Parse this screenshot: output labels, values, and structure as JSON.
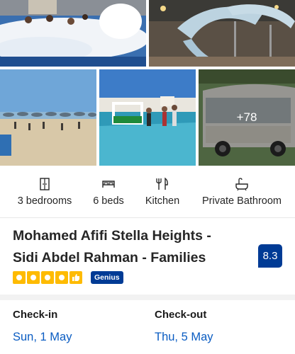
{
  "gallery": {
    "more_photos_label": "+78"
  },
  "amenities": [
    {
      "icon": "door-icon",
      "label": "3 bedrooms"
    },
    {
      "icon": "bed-icon",
      "label": "6 beds"
    },
    {
      "icon": "fork-knife-icon",
      "label": "Kitchen"
    },
    {
      "icon": "bathtub-icon",
      "label": "Private Bathroom"
    }
  ],
  "property": {
    "title_line1": "Mohamed Afifi Stella Heights -",
    "title_line2": "Sidi Abdel Rahman - Families",
    "score": "8.3",
    "stars": 4,
    "genius_label": "Genius"
  },
  "dates": {
    "checkin_label": "Check-in",
    "checkin_value": "Sun, 1 May",
    "checkout_label": "Check-out",
    "checkout_value": "Thu, 5 May"
  },
  "colors": {
    "brand_blue": "#003b95",
    "link_blue": "#0a5cc2",
    "star_yellow": "#febb02"
  }
}
